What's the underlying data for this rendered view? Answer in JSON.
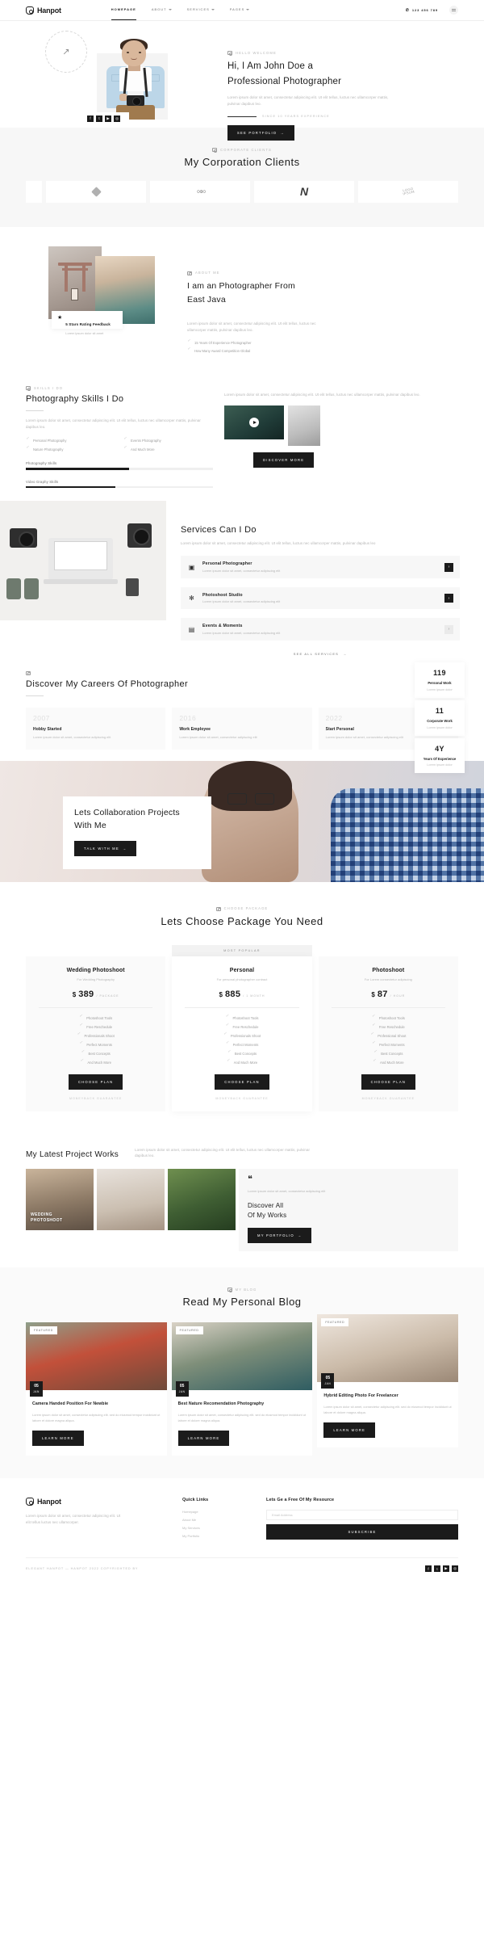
{
  "header": {
    "brand": "Hanpot",
    "nav": [
      {
        "label": "HOMEPAGE",
        "caret": false
      },
      {
        "label": "ABOUT",
        "caret": true
      },
      {
        "label": "SERVICES",
        "caret": true
      },
      {
        "label": "PAGES",
        "caret": true
      }
    ],
    "phone": "123 456 789"
  },
  "hero": {
    "eyebrow": "HELLO WELCOME",
    "title_line1": "Hi, I Am John Doe a",
    "title_line2": "Professional Photographer",
    "paragraph": "Lorem ipsum dolor sit amet, consectetur adipiscing elit. Ut elit tellus, luctus nec ullamcorper mattis, pulvinar dapibus leo.",
    "experience": "SINCE 10 YEARS EXPERIENCE",
    "cta": "SEE PORTFOLIO",
    "cta_arrow": "→",
    "socials": [
      "f",
      "t",
      "▶",
      "◎"
    ]
  },
  "clients": {
    "eyebrow": "CORPORATE CLIENTS",
    "title": "My Corporation Clients",
    "logos": [
      "partial",
      "diamond",
      "ooo",
      "n-mark",
      "logoipsum"
    ]
  },
  "about": {
    "eyebrow": "ABOUT ME",
    "title_line1": "I am an Photographer From",
    "title_line2": "East Java",
    "paragraph": "Lorem ipsum dolor sit amet, consectetur adipiscing elit. Ut elit tellus, luctus nec ullamcorper mattis, pulvinar dapibus leo.",
    "bullets": [
      "15 Years Of Experience Photographer",
      "How Many Award Competition Global"
    ],
    "feedback_title": "5 Stars Rating Feedback",
    "feedback_sub": "Lorem ipsum dolor sit amet",
    "feedback_star": "★"
  },
  "skills": {
    "eyebrow": "SKILLS I DO",
    "title": "Photography Skills I Do",
    "paragraph": "Lorem ipsum dolor sit amet, consectetur adipiscing elit. Ut elit tellus, luctus nec ullamcorper mattis, pulvinar dapibus leo.",
    "list": [
      "Personal Photography",
      "Events Photography",
      "Nature Photography",
      "And Much More"
    ],
    "bars": [
      {
        "label": "Photography Skills",
        "value": 55
      },
      {
        "label": "Video Graphy Skills",
        "value": 48
      }
    ],
    "right_paragraph": "Lorem ipsum dolor sit amet, consectetur adipiscing elit. Ut elit tellus, luctus nec ullamcorper mattis, pulvinar dapibus leo.",
    "cta": "DISCOVER MORE"
  },
  "services": {
    "title": "Services Can I Do",
    "paragraph": "Lorem ipsum dolor sit amet, consectetur adipiscing elit. Ut elit tellus, luctus nec ullamcorper mattis, pulvinar dapibus leo",
    "items": [
      {
        "icon": "camera-icon",
        "glyph": "▣",
        "title": "Personal Photographer",
        "sub": "Lorem ipsum dolor sit amet, consectetur adipiscing elit",
        "arrow": "›",
        "active": true
      },
      {
        "icon": "studio-icon",
        "glyph": "✻",
        "title": "Photoshoot Studio",
        "sub": "Lorem ipsum dolor sit amet, consectetur adipiscing elit",
        "arrow": "›",
        "active": true
      },
      {
        "icon": "event-icon",
        "glyph": "▤",
        "title": "Events & Moments",
        "sub": "Lorem ipsum dolor sit amet, consectetur adipiscing elit",
        "arrow": "›",
        "active": false
      }
    ],
    "more": "SEE ALL SERVICES",
    "more_arrow": "→"
  },
  "careers": {
    "title": "Discover My Careers Of Photographer",
    "timeline": [
      {
        "year": "2007",
        "title": "Hobby Started",
        "sub": "Lorem ipsum dolor sit amet, consectetur adipiscing elit"
      },
      {
        "year": "2016",
        "title": "Work Employee",
        "sub": "Lorem ipsum dolor sit amet, consectetur adipiscing elit"
      },
      {
        "year": "2022",
        "title": "Start Personal",
        "sub": "Lorem ipsum dolor sit amet, consectetur adipiscing elit"
      }
    ],
    "stats": [
      {
        "number": "119",
        "title": "Personal Work",
        "sub": "Lorem ipsum dolor"
      },
      {
        "number": "11",
        "title": "Corporate Work",
        "sub": "Lorem ipsum dolor"
      },
      {
        "number": "4Y",
        "title": "Years Of Experience",
        "sub": "Lorem ipsum dolor"
      }
    ]
  },
  "collab": {
    "title_line1": "Lets Collaboration Projects",
    "title_line2": "With Me",
    "cta": "TALK WITH ME",
    "cta_arrow": "→"
  },
  "pricing": {
    "eyebrow": "CHOOSE PACKAGE",
    "title": "Lets Choose Package You Need",
    "popular_badge": "MOST POPULAR",
    "plans": [
      {
        "name": "Wedding Photoshoot",
        "sub": "For Wedding Photography",
        "currency": "$",
        "amount": "389",
        "period": "/ PACKAGE",
        "features": [
          "Photoshoot Tools",
          "Free Reschedule",
          "Professionals Shoot",
          "Perfect Moments",
          "Best Concepts",
          "And Much More"
        ],
        "cta": "CHOOSE PLAN",
        "footnote": "MONEYBACK GUARANTEE",
        "popular": false
      },
      {
        "name": "Personal",
        "sub": "For personal photographer contract",
        "currency": "$",
        "amount": "885",
        "period": "/ 1 MONTH",
        "features": [
          "Photoshoot Tools",
          "Free Reschedule",
          "Professionals Shoot",
          "Perfect Moments",
          "Best Concepts",
          "And Much More"
        ],
        "cta": "CHOOSE PLAN",
        "footnote": "MONEYBACK GUARANTEE",
        "popular": true
      },
      {
        "name": "Photoshoot",
        "sub": "For Lorem consectetur adipiscing",
        "currency": "$",
        "amount": "87",
        "period": "/ HOUR",
        "features": [
          "Photoshoot Tools",
          "Free Reschedule",
          "Professional Shoot",
          "Perfect Moments",
          "Best Concepts",
          "And Much More"
        ],
        "cta": "CHOOSE PLAN",
        "footnote": "MONEYBACK GUARANTEE",
        "popular": false
      }
    ]
  },
  "portfolio": {
    "title": "My Latest Project Works",
    "paragraph": "Lorem ipsum dolor sit amet, consectetur adipiscing elit. Ut elit tellus, luctus nec ullamcorper mattis, pulvinar dapibus leo.",
    "items": [
      {
        "label_line1": "WEDDING",
        "label_line2": "PHOTOSHOOT"
      },
      {
        "label_line1": "",
        "label_line2": ""
      },
      {
        "label_line1": "",
        "label_line2": ""
      }
    ],
    "quote_mark": "❝",
    "quote_text": "Lorem ipsum dolor sit amet, consectetur adipiscing elit",
    "quote_title_line1": "Discover All",
    "quote_title_line2": "Of My Works",
    "quote_cta": "MY PORTFOLIO",
    "quote_cta_arrow": "→"
  },
  "blog": {
    "eyebrow": "MY BLOG",
    "title": "Read My Personal Blog",
    "posts": [
      {
        "tag": "Featured",
        "day": "05",
        "month": "JAN",
        "title": "Camera Handed Position For Newbie",
        "sub": "Lorem ipsum dolor sit amet, consectetur adipiscing elit. sed do eiusmod tempor incididunt ut labore et dolore magna aliqua.",
        "cta": "LEARN MORE"
      },
      {
        "tag": "Featured",
        "day": "05",
        "month": "JAN",
        "title": "Best Nature Recomendation Photography",
        "sub": "Lorem ipsum dolor sit amet, consectetur adipiscing elit. sed do eiusmod tempor incididunt ut labore et dolore magna aliqua.",
        "cta": "LEARN MORE"
      },
      {
        "tag": "Featured",
        "day": "05",
        "month": "JAN",
        "title": "Hybrid Editing Photo For Freelancer",
        "sub": "Lorem ipsum dolor sit amet, consectetur adipiscing elit. sed do eiusmod tempor incididunt ut labore et dolore magna aliqua.",
        "cta": "LEARN MORE"
      }
    ]
  },
  "footer": {
    "brand": "Hanpot",
    "about": "Lorem ipsum dolor sit amet, consectetur adipiscing elit. Ut elit tellus luctus nec ullamcorper.",
    "quick_links_title": "Quick Links",
    "quick_links": [
      "Homepage",
      "About Me",
      "My Services",
      "My Portfolio"
    ],
    "newsletter_title": "Lets Ge a Free Of My Resource",
    "newsletter_placeholder": "Email Address",
    "newsletter_button": "SUBSCRIBE",
    "copyright": "ELEGANT HANPOT — HANPOT 2022 COPYRIGHTED BY",
    "socials": [
      "f",
      "t",
      "▶",
      "◎"
    ]
  }
}
